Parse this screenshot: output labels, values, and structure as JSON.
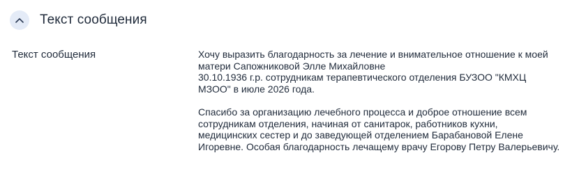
{
  "section": {
    "title": "Текст сообщения",
    "toggle_icon": "chevron-up-icon",
    "accent_color": "#e4ebf7"
  },
  "field": {
    "label": "Текст сообщения",
    "paragraphs": [
      "Хочу выразить благодарность за лечение и внимательное отношение к моей\nматери Сапожниковой Элле Михайловне\n30.10.1936 г.р. сотрудникам терапевтического отделения БУЗОО \"КМХЦ\nМЗОО\" в  июле 2026 года.",
      "Спасибо за организацию лечебного процесса и доброе отношение всем\nсотрудникам отделения, начиная от санитарок, работников кухни,\nмедицинских сестер и до заведующей отделением Барабановой Елене\nИгоревне. Особая благодарность лечащему врачу Егорову Петру Валерьевичу."
    ]
  }
}
